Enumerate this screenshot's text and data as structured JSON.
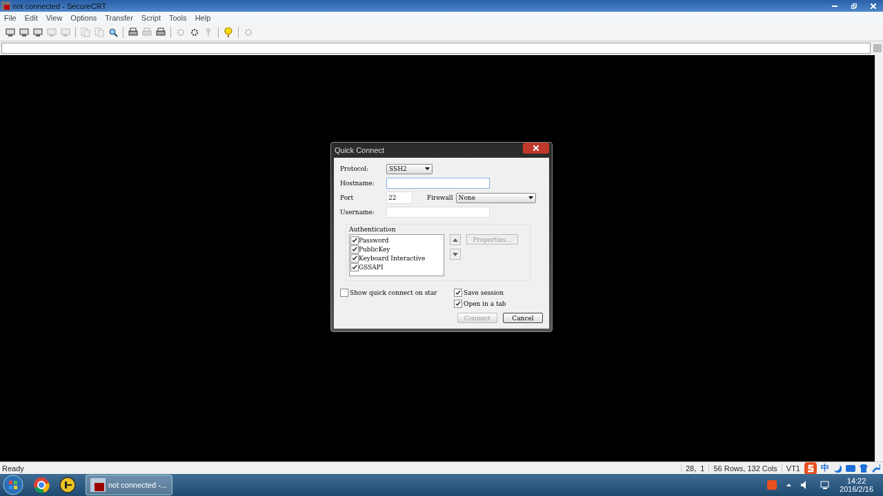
{
  "window": {
    "title": "not connected - SecureCRT"
  },
  "menu": [
    "File",
    "Edit",
    "View",
    "Options",
    "Transfer",
    "Script",
    "Tools",
    "Help"
  ],
  "toolbar": [
    {
      "kind": "connect",
      "disabled": false
    },
    {
      "kind": "connect",
      "disabled": false
    },
    {
      "kind": "connect",
      "disabled": false
    },
    {
      "kind": "connect",
      "disabled": true
    },
    {
      "kind": "connect",
      "disabled": true
    },
    {
      "kind": "sep"
    },
    {
      "kind": "copy",
      "disabled": true
    },
    {
      "kind": "copy",
      "disabled": true
    },
    {
      "kind": "find",
      "disabled": false
    },
    {
      "kind": "sep"
    },
    {
      "kind": "print",
      "disabled": false
    },
    {
      "kind": "print",
      "disabled": true
    },
    {
      "kind": "print",
      "disabled": false
    },
    {
      "kind": "sep"
    },
    {
      "kind": "options",
      "disabled": true
    },
    {
      "kind": "options",
      "disabled": false
    },
    {
      "kind": "key",
      "disabled": true
    },
    {
      "kind": "sep"
    },
    {
      "kind": "help",
      "disabled": false
    },
    {
      "kind": "sep"
    },
    {
      "kind": "options",
      "disabled": true
    }
  ],
  "dialog": {
    "title": "Quick Connect",
    "fields": [
      {
        "label": "Protocol:",
        "kind": "select",
        "value": "SSH2"
      },
      {
        "label": "Hostname:",
        "kind": "input",
        "focused": true
      },
      {
        "label": "Port",
        "kind": "port",
        "value": "22",
        "extra_label": "Firewall",
        "extra_value": "None"
      },
      {
        "label": "Username:",
        "kind": "input",
        "focused": false
      }
    ],
    "auth_title": "Authentication",
    "auth": [
      {
        "label": "Password",
        "checked": true
      },
      {
        "label": "PublicKey",
        "checked": true
      },
      {
        "label": "Keyboard Interactive",
        "checked": true
      },
      {
        "label": "GSSAPI",
        "checked": true
      }
    ],
    "properties": {
      "label": "Properties...",
      "disabled": true
    },
    "options": [
      {
        "label": "Show quick connect on star",
        "checked": false
      },
      {
        "label": "Save session",
        "checked": true
      },
      {
        "label": "Open in a tab",
        "checked": true
      }
    ],
    "buttons": [
      {
        "label": "Connect",
        "disabled": true
      },
      {
        "label": "Cancel",
        "disabled": false
      }
    ]
  },
  "status_bar": {
    "text": "Ready",
    "position": "28,  1",
    "size": "56 Rows, 132 Cols",
    "emulation": "VT1"
  },
  "ime": {
    "text": "中"
  },
  "taskbar": {
    "task": "not connected -...",
    "time": "14:22",
    "date": "2016/2/16"
  }
}
